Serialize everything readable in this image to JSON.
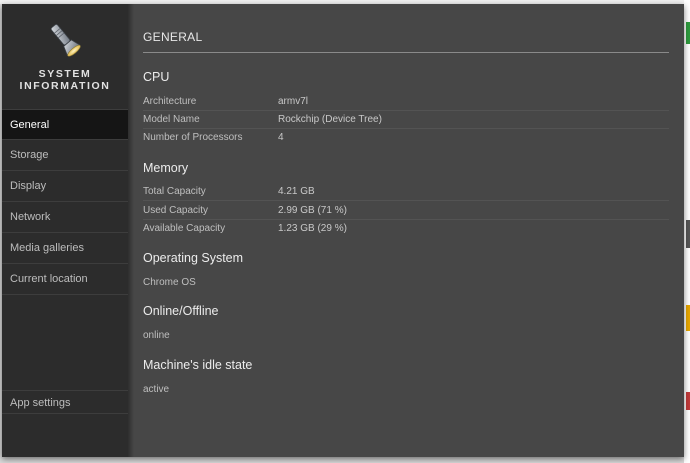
{
  "sidebar": {
    "brand_title_line1": "SYSTEM",
    "brand_title_line2": "INFORMATION",
    "brand_icon": "flashlight-icon",
    "items": [
      {
        "label": "General",
        "active": true
      },
      {
        "label": "Storage"
      },
      {
        "label": "Display"
      },
      {
        "label": "Network"
      },
      {
        "label": "Media galleries"
      },
      {
        "label": "Current location"
      }
    ],
    "app_settings": "App settings"
  },
  "main": {
    "title": "GENERAL",
    "cpu": {
      "heading": "CPU",
      "rows": [
        {
          "key": "Architecture",
          "value": "armv7l"
        },
        {
          "key": "Model Name",
          "value": "Rockchip (Device Tree)"
        },
        {
          "key": "Number of Processors",
          "value": "4"
        }
      ]
    },
    "memory": {
      "heading": "Memory",
      "rows": [
        {
          "key": "Total Capacity",
          "value": "4.21 GB"
        },
        {
          "key": "Used Capacity",
          "value": "2.99 GB (71 %)"
        },
        {
          "key": "Available Capacity",
          "value": "1.23 GB (29 %)"
        }
      ]
    },
    "os": {
      "heading": "Operating System",
      "value": "Chrome OS"
    },
    "online": {
      "heading": "Online/Offline",
      "value": "online"
    },
    "idle": {
      "heading": "Machine's idle state",
      "value": "active"
    }
  }
}
